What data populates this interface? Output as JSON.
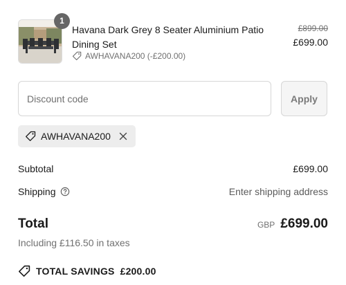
{
  "line_item": {
    "quantity": "1",
    "title": "Havana Dark Grey 8 Seater Aluminium Patio Dining Set",
    "discount_code_note": "AWHAVANA200 (-£200.00)",
    "original_price": "£899.00",
    "price": "£699.00",
    "thumbnail_icon": "patio-dining-set-image"
  },
  "discount": {
    "placeholder": "Discount code",
    "apply_label": "Apply",
    "applied_code": "AWHAVANA200"
  },
  "summary": {
    "subtotal_label": "Subtotal",
    "subtotal_value": "£699.00",
    "shipping_label": "Shipping",
    "shipping_value": "Enter shipping address",
    "total_label": "Total",
    "currency": "GBP",
    "total_value": "£699.00",
    "taxes_note": "Including £116.50 in taxes",
    "savings_label": "TOTAL SAVINGS",
    "savings_value": "£200.00"
  },
  "colors": {
    "badge": "#666666",
    "chip_bg": "#ededed",
    "muted_text": "#707070"
  }
}
